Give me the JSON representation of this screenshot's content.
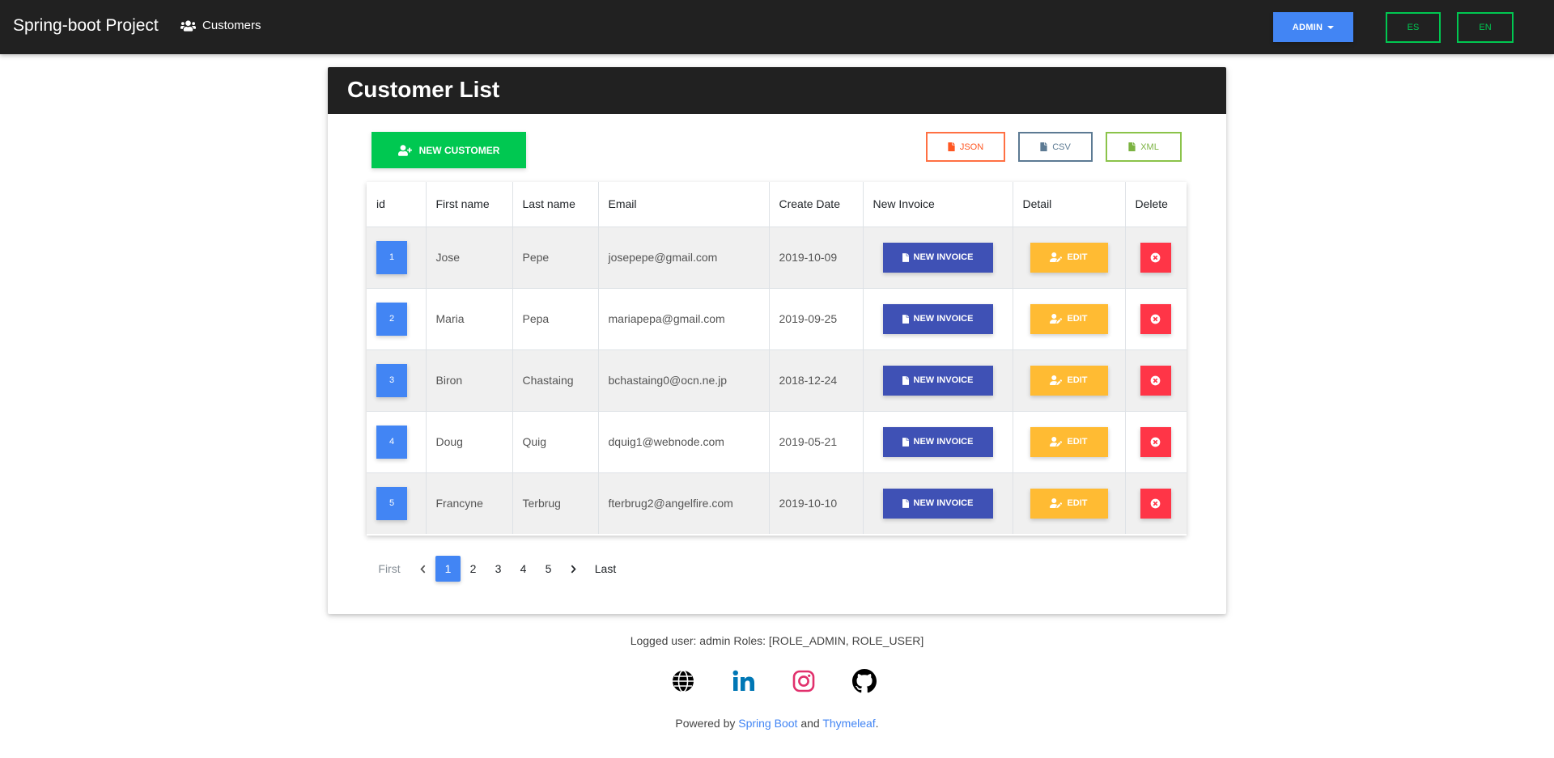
{
  "navbar": {
    "brand": "Spring-boot Project",
    "customers_link": "Customers",
    "admin_label": "ADMIN",
    "lang_es": "ES",
    "lang_en": "EN"
  },
  "card": {
    "title": "Customer List",
    "new_customer_label": "NEW CUSTOMER",
    "export": {
      "json": "JSON",
      "csv": "CSV",
      "xml": "XML"
    }
  },
  "table": {
    "headers": [
      "id",
      "First name",
      "Last name",
      "Email",
      "Create Date",
      "New Invoice",
      "Detail",
      "Delete"
    ],
    "new_invoice_label": "NEW INVOICE",
    "edit_label": "EDIT",
    "rows": [
      {
        "id": "1",
        "first": "Jose",
        "last": "Pepe",
        "email": "josepepe@gmail.com",
        "date": "2019-10-09"
      },
      {
        "id": "2",
        "first": "Maria",
        "last": "Pepa",
        "email": "mariapepa@gmail.com",
        "date": "2019-09-25"
      },
      {
        "id": "3",
        "first": "Biron",
        "last": "Chastaing",
        "email": "bchastaing0@ocn.ne.jp",
        "date": "2018-12-24"
      },
      {
        "id": "4",
        "first": "Doug",
        "last": "Quig",
        "email": "dquig1@webnode.com",
        "date": "2019-05-21"
      },
      {
        "id": "5",
        "first": "Francyne",
        "last": "Terbrug",
        "email": "fterbrug2@angelfire.com",
        "date": "2019-10-10"
      }
    ]
  },
  "pagination": {
    "first": "First",
    "pages": [
      "1",
      "2",
      "3",
      "4",
      "5"
    ],
    "active_page": "1",
    "last": "Last"
  },
  "footer": {
    "logged_user": "Logged user: admin Roles: [ROLE_ADMIN, ROLE_USER]",
    "powered_prefix": "Powered by",
    "spring_link": "Spring Boot",
    "and": "and",
    "thymeleaf_link": "Thymeleaf",
    "period": ".",
    "social_icons": [
      "globe-icon",
      "linkedin-icon",
      "instagram-icon",
      "github-icon"
    ]
  },
  "colors": {
    "navbar": "#212121",
    "primary": "#4285f4",
    "success": "#00c851",
    "indigo": "#3f51b5",
    "warning": "#ffbb33",
    "danger": "#ff3547",
    "json": "#ff5722",
    "csv": "#5c7a93",
    "xml": "#7cb342"
  }
}
